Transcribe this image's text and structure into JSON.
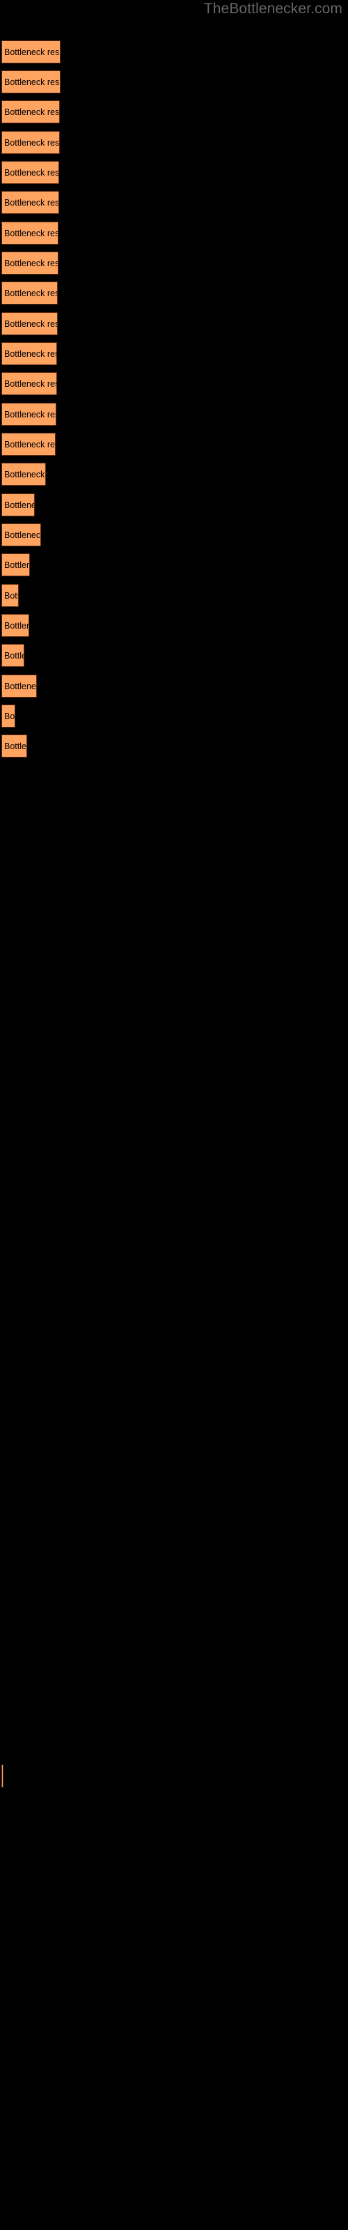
{
  "site": {
    "title": "TheBottlenecker.com",
    "title_color": "#666666"
  },
  "theme": {
    "background": "#000000",
    "bar_fill": "#ffa361",
    "bar_border": "#5e2b10",
    "label_color": "#000000"
  },
  "chart_data": {
    "type": "bar",
    "orientation": "horizontal",
    "title": "TheBottlenecker.com",
    "xlabel": "",
    "ylabel": "",
    "grid": false,
    "legend": false,
    "bar_label_text": "Bottleneck result",
    "categories": [
      "Bottleneck result",
      "Bottleneck result",
      "Bottleneck result",
      "Bottleneck result",
      "Bottleneck result",
      "Bottleneck result",
      "Bottleneck result",
      "Bottleneck result",
      "Bottleneck result",
      "Bottleneck result",
      "Bottleneck result",
      "Bottleneck result",
      "Bottleneck result",
      "Bottleneck result",
      "Bottleneck result",
      "Bottleneck result",
      "Bottleneck result",
      "Bottleneck result",
      "Bottleneck result",
      "Bottleneck result",
      "Bottleneck result",
      "Bottleneck result",
      "Bottleneck result",
      "Bottleneck result",
      "Bottleneck result",
      "Bottleneck result"
    ],
    "bars": [
      {
        "label": "Bottleneck result",
        "top": 58,
        "width": 85,
        "height": 33,
        "value": 85
      },
      {
        "label": "Bottleneck result",
        "top": 101,
        "width": 85,
        "height": 33,
        "value": 85
      },
      {
        "label": "Bottleneck result",
        "top": 144,
        "width": 84,
        "height": 33,
        "value": 84
      },
      {
        "label": "Bottleneck result",
        "top": 188,
        "width": 84,
        "height": 33,
        "value": 84
      },
      {
        "label": "Bottleneck result",
        "top": 231,
        "width": 83,
        "height": 33,
        "value": 83
      },
      {
        "label": "Bottleneck result",
        "top": 274,
        "width": 83,
        "height": 33,
        "value": 83
      },
      {
        "label": "Bottleneck result",
        "top": 318,
        "width": 82,
        "height": 33,
        "value": 82
      },
      {
        "label": "Bottleneck result",
        "top": 361,
        "width": 82,
        "height": 33,
        "value": 82
      },
      {
        "label": "Bottleneck result",
        "top": 404,
        "width": 81,
        "height": 33,
        "value": 81
      },
      {
        "label": "Bottleneck result",
        "top": 448,
        "width": 81,
        "height": 33,
        "value": 81
      },
      {
        "label": "Bottleneck result",
        "top": 491,
        "width": 80,
        "height": 33,
        "value": 80
      },
      {
        "label": "Bottleneck result",
        "top": 534,
        "width": 80,
        "height": 33,
        "value": 80
      },
      {
        "label": "Bottleneck result",
        "top": 578,
        "width": 79,
        "height": 33,
        "value": 79
      },
      {
        "label": "Bottleneck result",
        "top": 621,
        "width": 78,
        "height": 33,
        "value": 78
      },
      {
        "label": "Bottleneck result",
        "top": 664,
        "width": 64,
        "height": 33,
        "value": 64
      },
      {
        "label": "Bottleneck result",
        "top": 708,
        "width": 48,
        "height": 33,
        "value": 48
      },
      {
        "label": "Bottleneck result",
        "top": 751,
        "width": 57,
        "height": 33,
        "value": 57
      },
      {
        "label": "Bottleneck result",
        "top": 794,
        "width": 41,
        "height": 33,
        "value": 41
      },
      {
        "label": "Bottleneck result",
        "top": 838,
        "width": 25,
        "height": 33,
        "value": 25
      },
      {
        "label": "Bottleneck result",
        "top": 881,
        "width": 40,
        "height": 33,
        "value": 40
      },
      {
        "label": "Bottleneck result",
        "top": 924,
        "width": 33,
        "height": 33,
        "value": 33
      },
      {
        "label": "Bottleneck result",
        "top": 968,
        "width": 51,
        "height": 33,
        "value": 51
      },
      {
        "label": "Bottleneck result",
        "top": 1011,
        "width": 20,
        "height": 33,
        "value": 20
      },
      {
        "label": "Bottleneck result",
        "top": 1054,
        "width": 37,
        "height": 33,
        "value": 37
      },
      {
        "label": "Bottleneck result",
        "top": 2532,
        "width": 3,
        "height": 33,
        "value": 1
      }
    ],
    "xlim": [
      0,
      500
    ],
    "value_unit": "px"
  }
}
